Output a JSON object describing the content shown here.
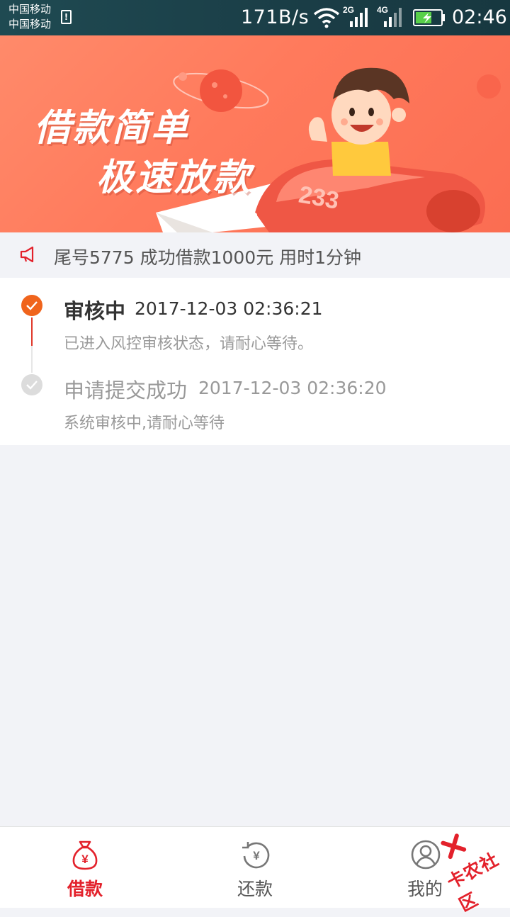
{
  "status_bar": {
    "carrier_1": "中国移动",
    "carrier_2": "中国移动",
    "net_speed": "171B/s",
    "signal_1_type": "2G",
    "signal_2_type": "4G",
    "time": "02:46",
    "icons": [
      "sim-icon",
      "wifi-icon",
      "signal-icon",
      "battery-charging-icon"
    ]
  },
  "banner": {
    "line_1": "借款简单",
    "line_2": "极速放款",
    "rocket_number": "233",
    "carousel_index": 1,
    "carousel_count": 1
  },
  "notice": {
    "text": "尾号5775 成功借款1000元 用时1分钟",
    "icon": "megaphone-icon",
    "icon_color": "#e3212b"
  },
  "timeline": [
    {
      "title": "审核中",
      "time": "2017-12-03 02:36:21",
      "description": "已进入风控审核状态，请耐心等待。",
      "state": "active",
      "color": "#f0641c"
    },
    {
      "title": "申请提交成功",
      "time": "2017-12-03 02:36:20",
      "description": "系统审核中,请耐心等待",
      "state": "done",
      "color": "#dcdcdc"
    }
  ],
  "tabs": [
    {
      "label": "借款",
      "icon": "money-bag-icon",
      "active": true
    },
    {
      "label": "还款",
      "icon": "repay-refresh-icon",
      "active": false
    },
    {
      "label": "我的",
      "icon": "user-profile-icon",
      "active": false
    }
  ],
  "watermark": {
    "text": "卡农社区"
  },
  "colors": {
    "accent": "#e3212b",
    "active_step": "#f0641c",
    "banner_bg": "#ff7a5c",
    "page_bg": "#f2f3f7"
  }
}
